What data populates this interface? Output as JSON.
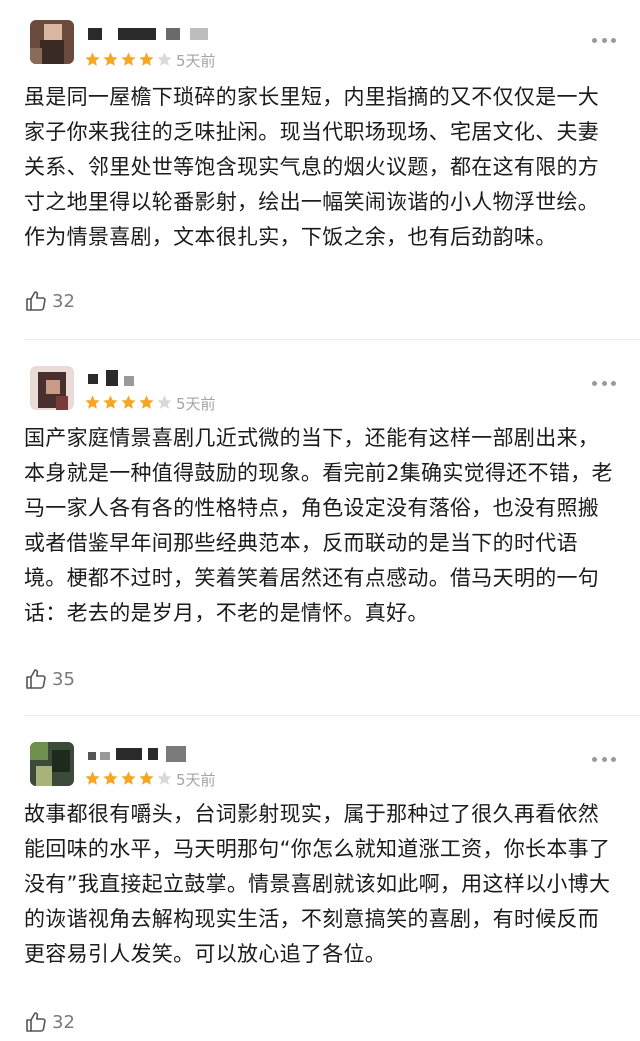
{
  "reviews": [
    {
      "rating": 4,
      "rating_max": 5,
      "time": "5天前",
      "text": "虽是同一屋檐下琐碎的家长里短，内里指摘的又不仅仅是一大家子你来我往的乏味扯闲。现当代职场现场、宅居文化、夫妻关系、邻里处世等饱含现实气息的烟火议题，都在这有限的方寸之地里得以轮番影射，绘出一幅笑闹诙谐的小人物浮世绘。作为情景喜剧，文本很扎实，下饭之余，也有后劲韵味。",
      "likes": "32"
    },
    {
      "rating": 4,
      "rating_max": 5,
      "time": "5天前",
      "text": "国产家庭情景喜剧几近式微的当下，还能有这样一部剧出来，本身就是一种值得鼓励的现象。看完前2集确实觉得还不错，老马一家人各有各的性格特点，角色设定没有落俗，也没有照搬或者借鉴早年间那些经典范本，反而联动的是当下的时代语境。梗都不过时，笑着笑着居然还有点感动。借马天明的一句话：老去的是岁月，不老的是情怀。真好。",
      "likes": "35"
    },
    {
      "rating": 4,
      "rating_max": 5,
      "time": "5天前",
      "text": "故事都很有嚼头，台词影射现实，属于那种过了很久再看依然能回味的水平，马天明那句“你怎么就知道涨工资，你长本事了没有”我直接起立鼓掌。情景喜剧就该如此啊，用这样以小博大的诙谐视角去解构现实生活，不刻意搞笑的喜剧，有时候反而更容易引人发笑。可以放心追了各位。",
      "likes": "32"
    }
  ],
  "colors": {
    "star_filled": "#f5a623",
    "star_empty": "#d9d9d9",
    "meta_text": "#a5a5a5"
  },
  "icons": {
    "like": "thumbs-up-icon",
    "more": "more-dots-icon",
    "star": "star-icon"
  }
}
